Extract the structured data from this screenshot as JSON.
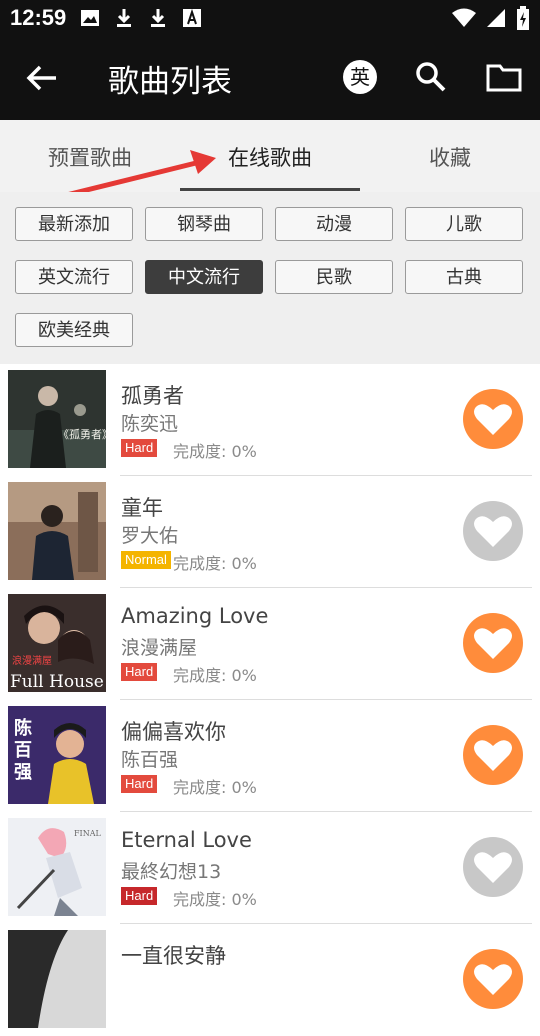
{
  "status_bar": {
    "time": "12:59"
  },
  "header": {
    "title": "歌曲列表",
    "lang_toggle": "英"
  },
  "tabs": [
    {
      "label": "预置歌曲"
    },
    {
      "label": "在线歌曲"
    },
    {
      "label": "收藏"
    }
  ],
  "categories": [
    {
      "label": "最新添加"
    },
    {
      "label": "钢琴曲"
    },
    {
      "label": "动漫"
    },
    {
      "label": "儿歌"
    },
    {
      "label": "英文流行"
    },
    {
      "label": "中文流行"
    },
    {
      "label": "民歌"
    },
    {
      "label": "古典"
    },
    {
      "label": "欧美经典"
    }
  ],
  "songs": [
    {
      "title": "孤勇者",
      "artist": "陈奕迅",
      "difficulty": "Hard",
      "progress_label": "完成度: 0%"
    },
    {
      "title": "童年",
      "artist": "罗大佑",
      "difficulty": "Normal",
      "progress_label": "完成度: 0%"
    },
    {
      "title": "Amazing Love",
      "artist": "浪漫满屋",
      "difficulty": "Hard",
      "progress_label": "完成度: 0%"
    },
    {
      "title": "偏偏喜欢你",
      "artist": "陈百强",
      "difficulty": "Hard",
      "progress_label": "完成度: 0%"
    },
    {
      "title": "Eternal Love",
      "artist": "最終幻想13",
      "difficulty": "Hard",
      "progress_label": "完成度: 0%"
    },
    {
      "title": "一直很安静",
      "artist": "",
      "difficulty": "",
      "progress_label": ""
    }
  ],
  "cover_texts": {
    "song1": "《孤勇者》",
    "song3": "Full House",
    "song4": "陈百强"
  },
  "colors": {
    "favorite_on": "#ff8c3b",
    "favorite_off": "#c8c8c8",
    "hard": "#e34a3d",
    "normal": "#f4b400",
    "appbar": "#111111"
  }
}
